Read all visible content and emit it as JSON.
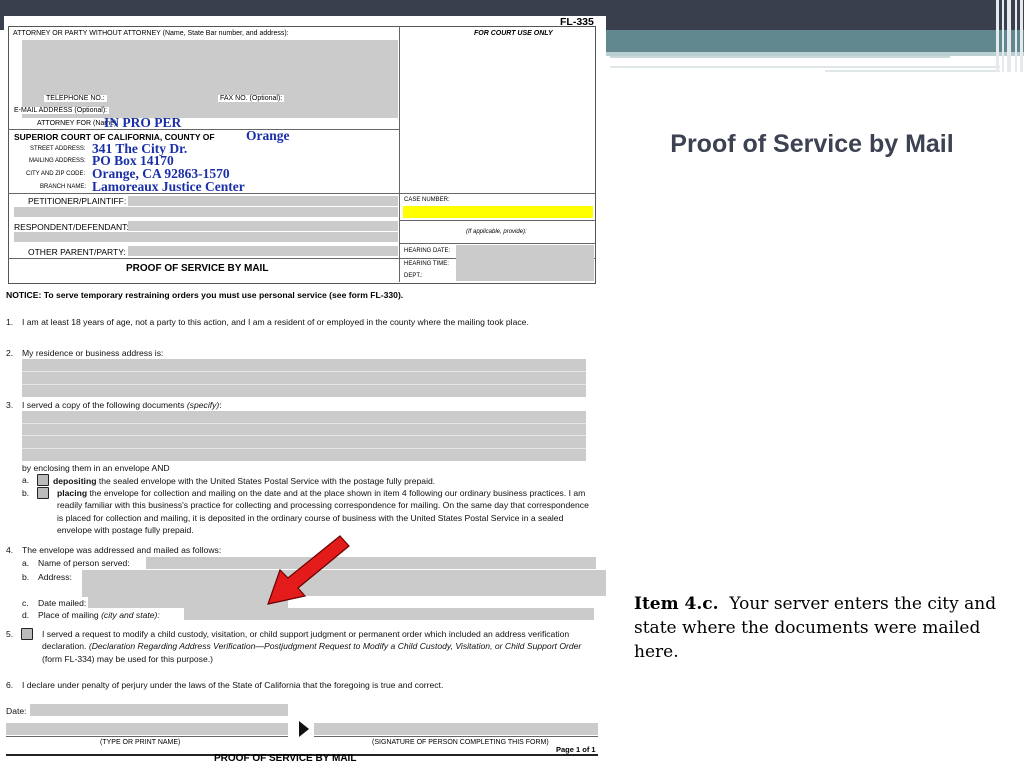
{
  "slide": {
    "title": "Proof of Service by Mail",
    "note_bold": "Item 4.c.",
    "note_text": "Your server enters the city and state where the documents were mailed here."
  },
  "form": {
    "form_number": "FL-335",
    "attorney_label": "ATTORNEY OR PARTY WITHOUT ATTORNEY (Name, State Bar number, and address):",
    "court_use_label": "FOR COURT USE ONLY",
    "telephone_label": "TELEPHONE NO.:",
    "fax_label": "FAX NO. (Optional):",
    "email_label": "E-MAIL ADDRESS (Optional):",
    "attorney_for_label": "ATTORNEY FOR (Name):",
    "attorney_for_value": "IN PRO PER",
    "court_label": "SUPERIOR COURT OF CALIFORNIA, COUNTY OF",
    "county_value": "Orange",
    "street_label": "STREET ADDRESS:",
    "street_value": "341 The City Dr.",
    "mailing_label": "MAILING ADDRESS:",
    "mailing_value": "PO Box 14170",
    "city_label": "CITY AND ZIP CODE:",
    "city_value": "Orange, CA  92863-1570",
    "branch_label": "BRANCH NAME:",
    "branch_value": "Lamoreaux Justice Center",
    "petitioner_label": "PETITIONER/PLAINTIFF:",
    "respondent_label": "RESPONDENT/DEFENDANT:",
    "other_label": "OTHER PARENT/PARTY:",
    "case_number_label": "CASE NUMBER:",
    "if_applicable": "(If applicable, provide):",
    "hearing_date_label": "HEARING DATE:",
    "hearing_time_label": "HEARING TIME:",
    "dept_label": "DEPT.:",
    "form_title": "PROOF OF SERVICE BY MAIL",
    "notice": "NOTICE: To serve temporary restraining orders you must use personal service (see form FL-330).",
    "item1_num": "1.",
    "item1": "I am at least 18 years of age, not a party to this action, and I am a resident of or employed in the county where the mailing took place.",
    "item2_num": "2.",
    "item2": "My residence or business address is:",
    "item3_num": "3.",
    "item3_a": "I served a copy of the following documents",
    "item3_b": "(specify)",
    "item3_c": ":",
    "enclosing": "by enclosing them in an envelope AND",
    "item3a_letter": "a.",
    "item3a_bold": "depositing",
    "item3a_rest": "the sealed envelope with the United States Postal Service with the postage fully prepaid.",
    "item3b_letter": "b.",
    "item3b_bold": "placing",
    "item3b_rest": "the envelope for collection and mailing on the date and at the place shown in item 4 following our ordinary business practices. I am readily familiar with this business's practice for collecting and processing correspondence for mailing. On the same day that correspondence is placed for collection and mailing, it is deposited in the ordinary course of business with the United States Postal Service in a sealed envelope with postage fully prepaid.",
    "item4_num": "4.",
    "item4": "The envelope was addressed and mailed as follows:",
    "item4a_letter": "a.",
    "item4a": "Name of person served:",
    "item4b_letter": "b.",
    "item4b": "Address:",
    "item4c_letter": "c.",
    "item4c": "Date mailed:",
    "item4d_letter": "d.",
    "item4d_a": "Place of mailing",
    "item4d_b": "(city and state):",
    "item5_num": "5.",
    "item5_a": "I served a request to modify a child custody, visitation, or child support judgment or permanent order which included an address verification declaration.",
    "item5_b": "(Declaration Regarding Address Verification—Postjudgment Request to Modify a Child Custody, Visitation, or Child Support Order",
    "item5_c": "(form FL-334) may be used for this purpose.)",
    "item6_num": "6.",
    "item6": "I declare under penalty of perjury under the laws of the State of California that the foregoing is true and correct.",
    "date_label": "Date:",
    "type_name_label": "(TYPE OR PRINT NAME)",
    "signature_label": "(SIGNATURE OF PERSON COMPLETING THIS FORM)",
    "page_label": "Page 1 of 1",
    "footer_title": "PROOF OF SERVICE BY MAIL"
  },
  "colors": {
    "top_bar": "#3a3f4e",
    "teal_bar": "#62888f",
    "title_color": "#3c4252",
    "filled_text": "#1a2fa8",
    "case_highlight": "#ffff00",
    "arrow": "#e31b1b"
  },
  "icons": [
    "red-arrow-icon",
    "triangle-pointer-icon",
    "checkbox-icon"
  ]
}
